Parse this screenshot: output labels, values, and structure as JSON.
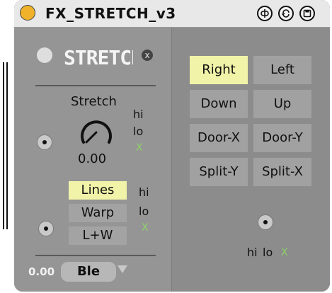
{
  "window": {
    "title": "FX_STRETCH_v3"
  },
  "title_buttons": [
    {
      "name": "link-icon"
    },
    {
      "name": "refresh-icon"
    },
    {
      "name": "save-icon"
    }
  ],
  "header": {
    "logo_text": "STRETCH",
    "close_symbol": "x"
  },
  "stretch": {
    "label": "Stretch",
    "value": "0.00",
    "hi": "hi",
    "lo": "lo",
    "x": "X"
  },
  "mode": {
    "buttons": [
      "Lines",
      "Warp",
      "L+W"
    ],
    "active_index": 0,
    "hi": "hi",
    "lo": "lo",
    "x": "X"
  },
  "bottom": {
    "value": "0.00",
    "selected": "Ble"
  },
  "directions": {
    "buttons": [
      "Right",
      "Left",
      "Down",
      "Up",
      "Door-X",
      "Door-Y",
      "Split-Y",
      "Split-X"
    ],
    "active_index": 0
  },
  "right_footer": {
    "hi": "hi",
    "lo": "lo",
    "x": "X"
  },
  "colors": {
    "title_dot": "#f0b22a",
    "active_button": "#f1f3a8",
    "indicator_green": "#8fd06a"
  }
}
